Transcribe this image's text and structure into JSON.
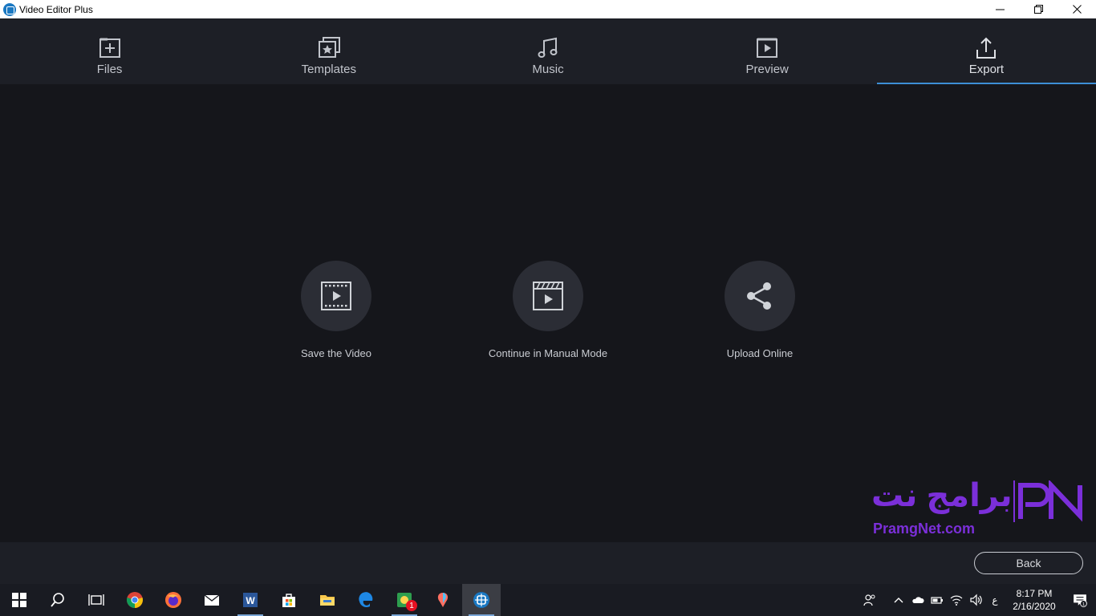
{
  "window": {
    "title": "Video Editor Plus"
  },
  "nav": {
    "tabs": [
      {
        "label": "Files",
        "icon": "add-file-icon"
      },
      {
        "label": "Templates",
        "icon": "templates-star-icon"
      },
      {
        "label": "Music",
        "icon": "music-note-icon"
      },
      {
        "label": "Preview",
        "icon": "play-preview-icon"
      },
      {
        "label": "Export",
        "icon": "export-upload-icon",
        "active": true
      }
    ],
    "accent_color": "#3d8fd6"
  },
  "export_options": [
    {
      "label": "Save the Video",
      "icon": "film-play-icon"
    },
    {
      "label": "Continue in Manual Mode",
      "icon": "clapperboard-icon"
    },
    {
      "label": "Upload Online",
      "icon": "share-icon"
    }
  ],
  "footer": {
    "back_label": "Back"
  },
  "watermark": {
    "arabic_text": "برامج نت",
    "latin_text": "PramgNet.com",
    "logo_text": "PN",
    "color": "#7b2fd9"
  },
  "taskbar": {
    "apps": [
      "windows-start-icon",
      "search-icon",
      "task-view-icon",
      "chrome-icon",
      "firefox-icon",
      "mail-icon",
      "word-icon",
      "store-icon",
      "file-explorer-icon",
      "edge-icon",
      "photos-app-icon",
      "paint-3d-icon",
      "video-editor-plus-icon"
    ],
    "photos_badge": "1",
    "language": "ع",
    "time": "8:17 PM",
    "date": "2/16/2020",
    "notification_count": "1"
  }
}
